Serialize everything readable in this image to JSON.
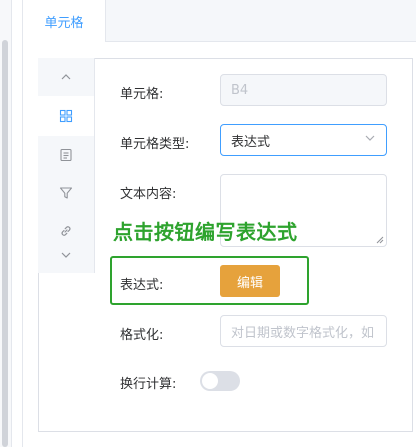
{
  "tabs": [
    {
      "label": "单元格",
      "active": true
    }
  ],
  "side_nav": {
    "items": [
      {
        "name": "collapse-up",
        "icon": "chevron-up-icon"
      },
      {
        "name": "cell-grid",
        "icon": "grid-icon",
        "active": true
      },
      {
        "name": "document",
        "icon": "document-icon"
      },
      {
        "name": "filter",
        "icon": "filter-icon"
      },
      {
        "name": "link",
        "icon": "link-icon"
      },
      {
        "name": "collapse-down",
        "icon": "chevron-down-icon"
      }
    ]
  },
  "form": {
    "cell_label": "单元格:",
    "cell_value": "B4",
    "cell_type_label": "单元格类型:",
    "cell_type_value": "表达式",
    "text_content_label": "文本内容:",
    "text_content_value": "",
    "expression_label": "表达式:",
    "edit_button": "编辑",
    "format_label": "格式化:",
    "format_placeholder": "对日期或数字格式化，如",
    "wrap_calc_label": "换行计算:",
    "wrap_calc_enabled": false
  },
  "annotation": {
    "hint_text": "点击按钮编写表达式",
    "color": "#2ea32e"
  },
  "colors": {
    "accent": "#409eff",
    "edit_button": "#e6a23c"
  }
}
